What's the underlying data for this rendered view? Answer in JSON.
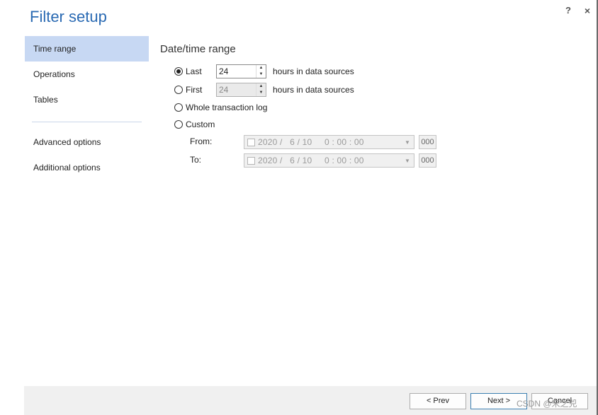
{
  "window": {
    "title": "Filter setup",
    "help_label": "?",
    "close_label": "×"
  },
  "nav": {
    "items": [
      "Time range",
      "Operations",
      "Tables"
    ],
    "items2": [
      "Advanced options",
      "Additional options"
    ]
  },
  "section": {
    "title": "Date/time range"
  },
  "options": {
    "last": {
      "label": "Last",
      "value": "24",
      "suffix": "hours in data sources",
      "checked": true
    },
    "first": {
      "label": "First",
      "value": "24",
      "suffix": "hours in data sources",
      "checked": false
    },
    "whole": {
      "label": "Whole transaction log",
      "checked": false
    },
    "custom": {
      "label": "Custom",
      "checked": false
    }
  },
  "custom_range": {
    "from": {
      "label": "From:",
      "value": "2020 /   6 / 10     0 : 00 : 00",
      "ms": "000"
    },
    "to": {
      "label": "To:",
      "value": "2020 /   6 / 10     0 : 00 : 00",
      "ms": "000"
    }
  },
  "footer": {
    "prev_label": "< Prev",
    "next_label": "Next >",
    "cancel_label": "Cancel"
  },
  "watermark": "CSDN @宋之兕",
  "colors": {
    "title": "#2a6ab3",
    "nav_selected": "#c7d8f3",
    "footer_bg": "#f0f0f0"
  }
}
